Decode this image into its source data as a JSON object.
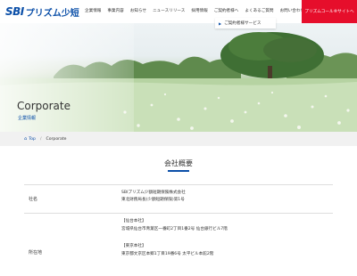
{
  "header": {
    "logo_sbi": "SBI",
    "logo_name": "プリズム少短",
    "nav": [
      "企業情報",
      "事業内容",
      "お知らせ",
      "ニュースリリース",
      "採用情報",
      "ご契約者様へ",
      "よくあるご質問",
      "お問い合わせ"
    ],
    "call_button": "プリズムコール®サイトへ",
    "dropdown_item": "ご契約者様サービス"
  },
  "hero": {
    "title": "Corporate",
    "subtitle": "企業情報"
  },
  "breadcrumb": {
    "home": "Top",
    "separator": "/",
    "current": "Corporate"
  },
  "section": {
    "title": "会社概要"
  },
  "company_table": {
    "name_label": "社名",
    "name_line1": "SBIプリズム少額短期保険株式会社",
    "name_line2": "東北財務局長(少額短期保険)第1号",
    "hq_label": "所在地",
    "hq_sendai_heading": "【仙台本社】",
    "hq_sendai_address": "宮城県仙台市青葉区一番町2丁目1番2号 仙台銀行ビル7階",
    "hq_tokyo_heading": "【東京本社】",
    "hq_tokyo_address": "東京都文京区本郷1丁目19番6号 太平ビル本館2階"
  },
  "colors": {
    "brand_blue": "#0b4fa8",
    "cta_red": "#e60e2b"
  }
}
